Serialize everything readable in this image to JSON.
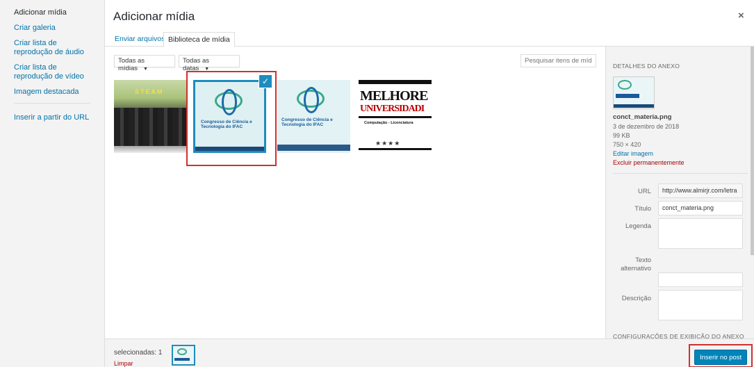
{
  "menu": {
    "items": [
      {
        "label": "Adicionar mídia",
        "active": true
      },
      {
        "label": "Criar galeria"
      },
      {
        "label": "Criar lista de reprodução de áudio"
      },
      {
        "label": "Criar lista de reprodução de vídeo"
      },
      {
        "label": "Imagem destacada"
      },
      {
        "label": "Inserir a partir do URL"
      }
    ]
  },
  "header": {
    "title": "Adicionar mídia",
    "close": "×"
  },
  "tabs": [
    "Enviar arquivos",
    "Biblioteca de mídia"
  ],
  "toolbar": {
    "filter_type": "Todas as mídias",
    "filter_date": "Todas as datas",
    "search_placeholder": "Pesquisar itens de mídia"
  },
  "grid": {
    "thumb1_text": "STEAM",
    "thumb2_text": "Congresso de Ciência e Tecnologia do IFAC",
    "thumb3_text": "Congresso de Ciência e Tecnologia do IFAC",
    "thumb4_line1": "MELHORE",
    "thumb4_line2": "UNIVERSIDADI",
    "thumb4_line3": "Computação - Licenciatura",
    "thumb4_stars": "★★★★",
    "check": "✓"
  },
  "details": {
    "heading": "DETALHES DO ANEXO",
    "filename": "conct_materia.png",
    "date": "3 de dezembro de 2018",
    "size": "99 KB",
    "dimensions": "750 × 420",
    "edit_link": "Editar imagem",
    "delete_link": "Excluir permanentemente",
    "url_label": "URL",
    "url_value": "http://www.almirjr.com/letra",
    "title_label": "Título",
    "title_value": "conct_materia.png",
    "caption_label": "Legenda",
    "alt_label": "Texto alternativo",
    "description_label": "Descrição",
    "settings_heading": "CONFIGURAÇÕES DE EXIBIÇÃO DO ANEXO"
  },
  "footer": {
    "selected_count": "selecionadas: 1",
    "clear": "Limpar",
    "insert": "Inserir no post"
  },
  "colors": {
    "accent": "#0085ba",
    "selection": "#1e8cbe",
    "highlight": "#d03030"
  }
}
